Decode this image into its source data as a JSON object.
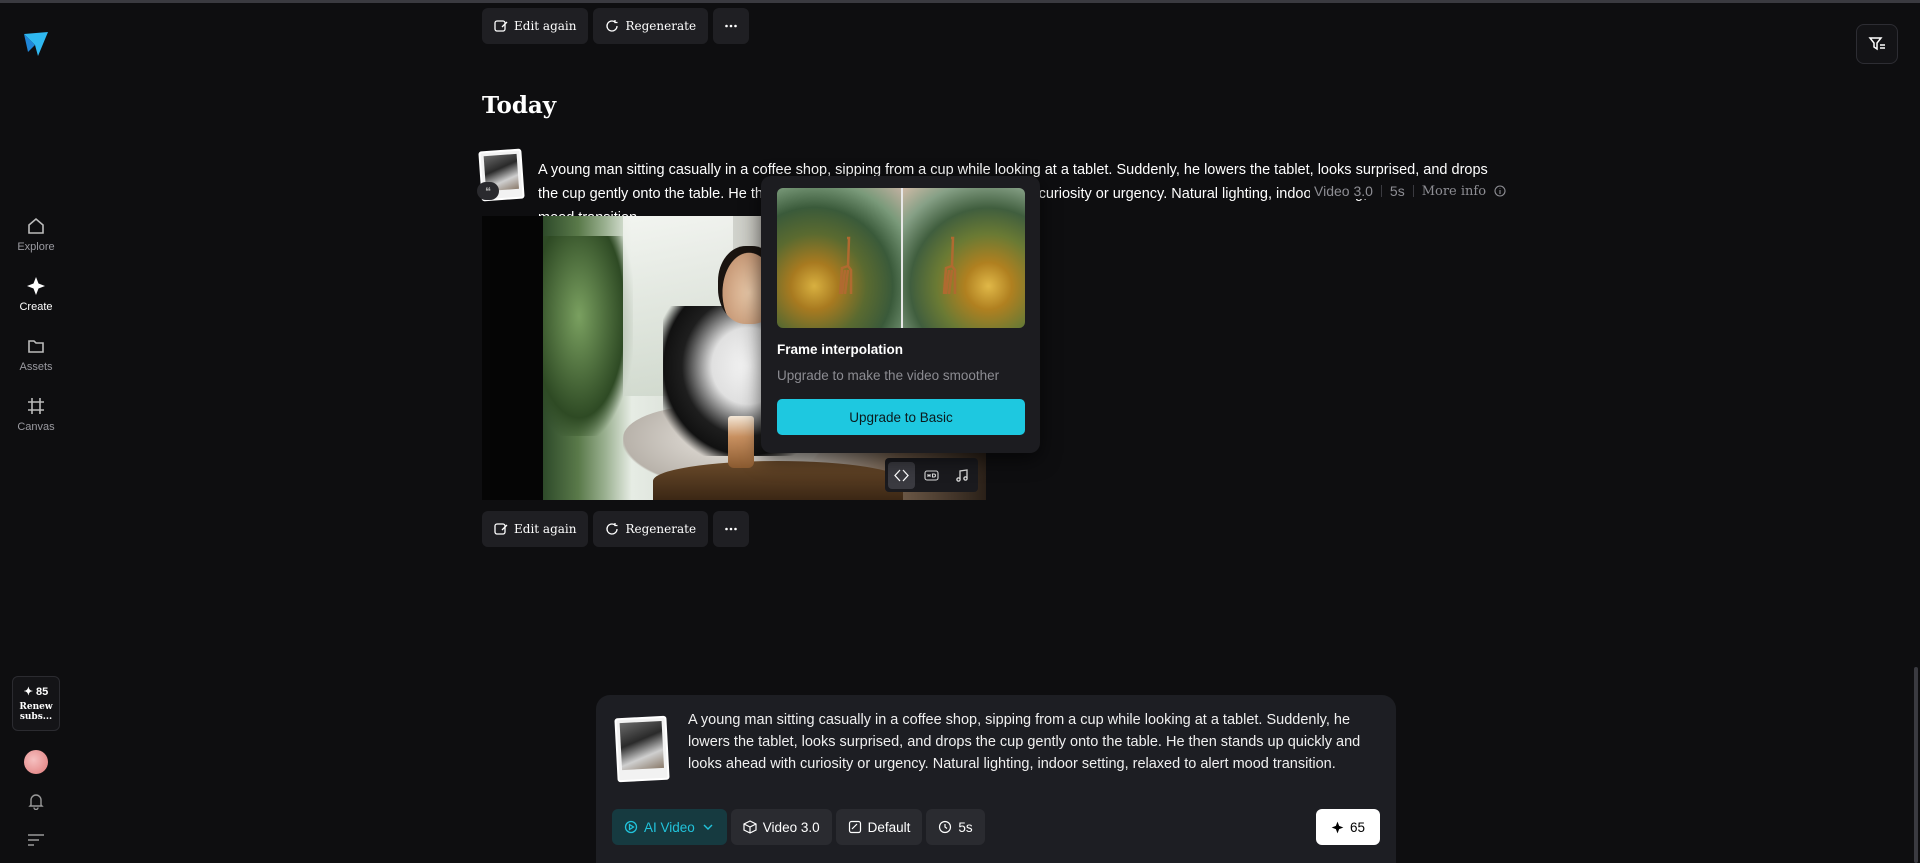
{
  "sidebar": {
    "items": [
      {
        "label": "Explore",
        "icon": "home-icon"
      },
      {
        "label": "Create",
        "icon": "sparkle-icon"
      },
      {
        "label": "Assets",
        "icon": "folder-icon"
      },
      {
        "label": "Canvas",
        "icon": "canvas-icon"
      }
    ],
    "credits": "✦ 85",
    "renew_label": "Renew subs..."
  },
  "top_actions": {
    "edit_label": "Edit again",
    "regen_label": "Regenerate"
  },
  "section_title": "Today",
  "generation": {
    "prompt": "A young man sitting casually in a coffee shop, sipping from a cup while looking at a tablet. Suddenly, he lowers the tablet, looks surprised, and drops the cup gently onto the table. He then stands up quickly and looks ahead with curiosity or urgency. Natural lighting, indoor setting, relaxed to alert mood transition.",
    "quote_icon": "quote-icon",
    "model": "Video 3.0",
    "duration": "5s",
    "more_info": "More info"
  },
  "bottom_actions": {
    "edit_label": "Edit again",
    "regen_label": "Regenerate"
  },
  "popup": {
    "title": "Frame interpolation",
    "subtitle": "Upgrade to make the video smoother",
    "button": "Upgrade to Basic"
  },
  "composer": {
    "prompt": "A young man sitting casually in a coffee shop, sipping from a cup while looking at a tablet. Suddenly, he lowers the tablet, looks surprised, and drops the cup gently onto the table. He then stands up quickly and looks ahead with curiosity or urgency. Natural lighting, indoor setting, relaxed to alert mood transition.",
    "mode": "AI Video",
    "model": "Video 3.0",
    "ratio": "Default",
    "duration": "5s",
    "cost": "65"
  },
  "colors": {
    "accent": "#1ec8e0",
    "background": "#0e0e10"
  }
}
